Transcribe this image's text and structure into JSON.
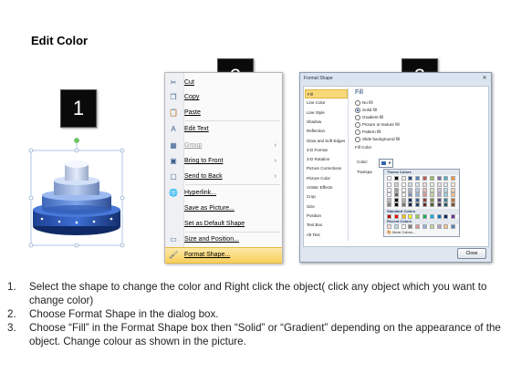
{
  "title": "Edit Color",
  "badges": [
    "1",
    "2",
    "3"
  ],
  "context_menu": {
    "items": [
      {
        "icon": "cut-icon",
        "glyph": "✂",
        "label": "Cut",
        "has_submenu": false,
        "disabled": false
      },
      {
        "icon": "copy-icon",
        "glyph": "❐",
        "label": "Copy",
        "has_submenu": false,
        "disabled": false
      },
      {
        "icon": "paste-icon",
        "glyph": "📋",
        "label": "Paste",
        "has_submenu": false,
        "disabled": false
      },
      {
        "icon": "edit-text-icon",
        "glyph": "A",
        "label": "Edit Text",
        "has_submenu": false,
        "disabled": false
      },
      {
        "icon": "group-icon",
        "glyph": "▦",
        "label": "Group",
        "has_submenu": true,
        "disabled": true
      },
      {
        "icon": "bring-to-front-icon",
        "glyph": "▣",
        "label": "Bring to Front",
        "has_submenu": true,
        "disabled": false
      },
      {
        "icon": "send-to-back-icon",
        "glyph": "▢",
        "label": "Send to Back",
        "has_submenu": true,
        "disabled": false
      },
      {
        "icon": "hyperlink-icon",
        "glyph": "🌐",
        "label": "Hyperlink...",
        "has_submenu": false,
        "disabled": false
      },
      {
        "icon": "save-picture-icon",
        "glyph": "",
        "label": "Save as Picture...",
        "has_submenu": false,
        "disabled": false
      },
      {
        "icon": "default-shape-icon",
        "glyph": "",
        "label": "Set as Default Shape",
        "has_submenu": false,
        "disabled": false
      },
      {
        "icon": "size-position-icon",
        "glyph": "▭",
        "label": "Size and Position...",
        "has_submenu": false,
        "disabled": false
      },
      {
        "icon": "format-shape-icon",
        "glyph": "🖌",
        "label": "Format Shape...",
        "has_submenu": false,
        "disabled": false,
        "selected": true
      }
    ]
  },
  "dialog": {
    "title": "Format Shape",
    "nav": [
      "Fill",
      "Line Color",
      "Line Style",
      "Shadow",
      "Reflection",
      "Glow and Soft Edges",
      "3-D Format",
      "3-D Rotation",
      "Picture Corrections",
      "Picture Color",
      "Artistic Effects",
      "Crop",
      "Size",
      "Position",
      "Text Box",
      "Alt Text"
    ],
    "selected_nav": "Fill",
    "pane_title": "Fill",
    "fill_options": [
      {
        "label": "No fill",
        "on": false
      },
      {
        "label": "Solid fill",
        "on": true
      },
      {
        "label": "Gradient fill",
        "on": false
      },
      {
        "label": "Picture or texture fill",
        "on": false
      },
      {
        "label": "Pattern fill",
        "on": false
      },
      {
        "label": "Slide background fill",
        "on": false
      }
    ],
    "fill_color_label": "Fill Color",
    "color_label": "Color:",
    "transparency_label": "Transpa",
    "palette": {
      "theme_header": "Theme Colors",
      "standard_header": "Standard Colors",
      "recent_header": "Recent Colors",
      "more_colors": "More Colors...",
      "theme_top": [
        "#ffffff",
        "#000000",
        "#eeece1",
        "#1f497d",
        "#4f81bd",
        "#c0504d",
        "#9bbb59",
        "#8064a2",
        "#4bacc6",
        "#f79646"
      ],
      "standard": [
        "#c00000",
        "#ff0000",
        "#ffc000",
        "#ffff00",
        "#92d050",
        "#00b050",
        "#00b0f0",
        "#0070c0",
        "#002060",
        "#7030a0"
      ],
      "recent": [
        "#f2dcdb",
        "#b7dde8",
        "#ffffff",
        "#7f7f7f",
        "#d99694",
        "#95b3d7",
        "#c3d69b",
        "#b2a2c7",
        "#fac08f",
        "#4f81bd"
      ]
    },
    "close_label": "Close"
  },
  "instructions": [
    {
      "num": "1.",
      "text": "Select the shape to change the color and Right click the object( click any object which you want to change color)"
    },
    {
      "num": "2.",
      "text": "Choose Format Shape in the dialog box."
    },
    {
      "num": "3.",
      "text": "Choose “Fill” in the Format Shape box then “Solid” or “Gradient” depending on the appearance of the object. Change colour as shown in the picture."
    }
  ]
}
